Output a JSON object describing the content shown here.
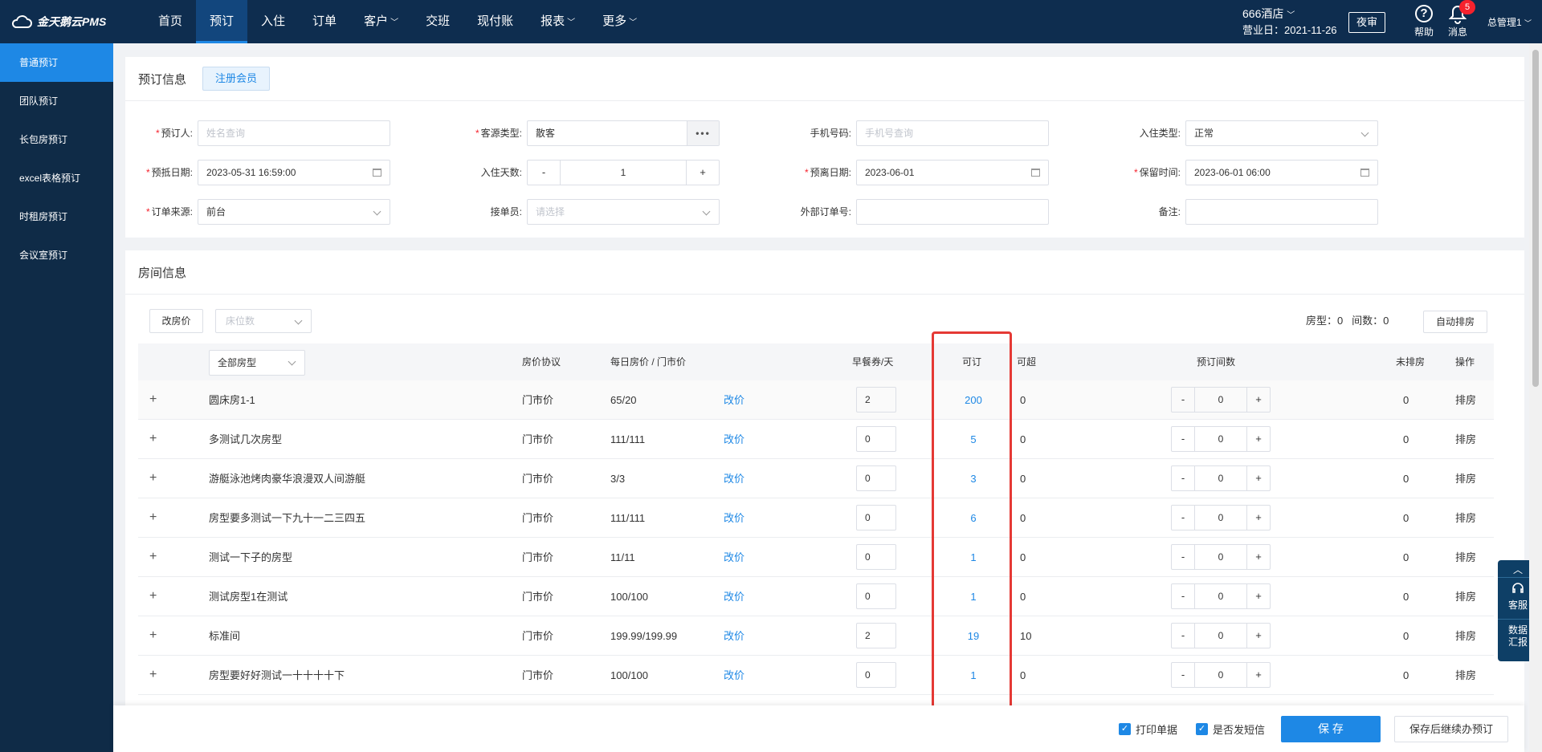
{
  "brand": {
    "name": "金天鹅云PMS"
  },
  "nav": [
    {
      "label": "首页",
      "active": false,
      "caret": false
    },
    {
      "label": "预订",
      "active": true,
      "caret": false
    },
    {
      "label": "入住",
      "active": false,
      "caret": false
    },
    {
      "label": "订单",
      "active": false,
      "caret": false
    },
    {
      "label": "客户",
      "active": false,
      "caret": true
    },
    {
      "label": "交班",
      "active": false,
      "caret": false
    },
    {
      "label": "现付账",
      "active": false,
      "caret": false
    },
    {
      "label": "报表",
      "active": false,
      "caret": true
    },
    {
      "label": "更多",
      "active": false,
      "caret": true
    }
  ],
  "header": {
    "hotel": "666酒店",
    "business_date": "营业日：2021-11-26",
    "night_audit": "夜审",
    "help": "帮助",
    "messages": "消息",
    "message_count": "5",
    "user": "总管理1"
  },
  "sidebar": [
    {
      "label": "普通预订",
      "active": true
    },
    {
      "label": "团队预订",
      "active": false
    },
    {
      "label": "长包房预订",
      "active": false
    },
    {
      "label": "excel表格预订",
      "active": false
    },
    {
      "label": "时租房预订",
      "active": false
    },
    {
      "label": "会议室预订",
      "active": false
    }
  ],
  "booking": {
    "title": "预订信息",
    "register_member": "注册会员",
    "booker_label": "预订人:",
    "booker_placeholder": "姓名查询",
    "source_type_label": "客源类型:",
    "source_type_value": "散客",
    "phone_label": "手机号码:",
    "phone_placeholder": "手机号查询",
    "checkin_type_label": "入住类型:",
    "checkin_type_value": "正常",
    "arrival_label": "预抵日期:",
    "arrival_value": "2023-05-31 16:59:00",
    "days_label": "入住天数:",
    "days_value": "1",
    "minus": "-",
    "plus": "+",
    "departure_label": "预离日期:",
    "departure_value": "2023-06-01",
    "hold_label": "保留时间:",
    "hold_value": "2023-06-01 06:00",
    "order_source_label": "订单来源:",
    "order_source_value": "前台",
    "receiver_label": "接单员:",
    "receiver_placeholder": "请选择",
    "external_label": "外部订单号:",
    "external_value": "",
    "remark_label": "备注:",
    "remark_value": ""
  },
  "rooms": {
    "title": "房间信息",
    "change_price": "改房价",
    "bed_placeholder": "床位数",
    "room_type_label": "房型：",
    "room_type_count": "0",
    "room_count_label": "间数：",
    "room_count": "0",
    "auto_assign": "自动排房",
    "columns": {
      "room_type_filter": "全部房型",
      "agreement": "房价协议",
      "daily_price": "每日房价 / 门市价",
      "breakfast": "早餐券/天",
      "available": "可订",
      "oversell": "可超",
      "booked": "预订间数",
      "unassigned": "未排房",
      "action": "操作"
    },
    "rows": [
      {
        "name": "圆床房1-1",
        "agreement": "门市价",
        "price": "65/20",
        "edit": "改价",
        "breakfast": "2",
        "available": "200",
        "oversell": "0",
        "booked": "0",
        "unassigned": "0",
        "action": "排房"
      },
      {
        "name": "多测试几次房型",
        "agreement": "门市价",
        "price": "111/111",
        "edit": "改价",
        "breakfast": "0",
        "available": "5",
        "oversell": "0",
        "booked": "0",
        "unassigned": "0",
        "action": "排房"
      },
      {
        "name": "游艇泳池烤肉豪华浪漫双人间游艇",
        "agreement": "门市价",
        "price": "3/3",
        "edit": "改价",
        "breakfast": "0",
        "available": "3",
        "oversell": "0",
        "booked": "0",
        "unassigned": "0",
        "action": "排房"
      },
      {
        "name": "房型要多测试一下九十一二三四五",
        "agreement": "门市价",
        "price": "111/111",
        "edit": "改价",
        "breakfast": "0",
        "available": "6",
        "oversell": "0",
        "booked": "0",
        "unassigned": "0",
        "action": "排房"
      },
      {
        "name": "测试一下子的房型",
        "agreement": "门市价",
        "price": "11/11",
        "edit": "改价",
        "breakfast": "0",
        "available": "1",
        "oversell": "0",
        "booked": "0",
        "unassigned": "0",
        "action": "排房"
      },
      {
        "name": "测试房型1在测试",
        "agreement": "门市价",
        "price": "100/100",
        "edit": "改价",
        "breakfast": "0",
        "available": "1",
        "oversell": "0",
        "booked": "0",
        "unassigned": "0",
        "action": "排房"
      },
      {
        "name": "标准间",
        "agreement": "门市价",
        "price": "199.99/199.99",
        "edit": "改价",
        "breakfast": "2",
        "available": "19",
        "oversell": "10",
        "booked": "0",
        "unassigned": "0",
        "action": "排房"
      },
      {
        "name": "房型要好好测试一十十十十下",
        "agreement": "门市价",
        "price": "100/100",
        "edit": "改价",
        "breakfast": "0",
        "available": "1",
        "oversell": "0",
        "booked": "0",
        "unassigned": "0",
        "action": "排房"
      }
    ]
  },
  "footer": {
    "print_receipt": "打印单据",
    "send_sms": "是否发短信",
    "save": "保 存",
    "save_continue": "保存后继续办预订"
  },
  "float_widget": {
    "service": "客服",
    "report_line1": "数据",
    "report_line2": "汇报"
  },
  "colors": {
    "topbar": "#0e2d4f",
    "sidebar": "#0f2b47",
    "accent": "#1e88e5",
    "highlight": "#e53935"
  }
}
